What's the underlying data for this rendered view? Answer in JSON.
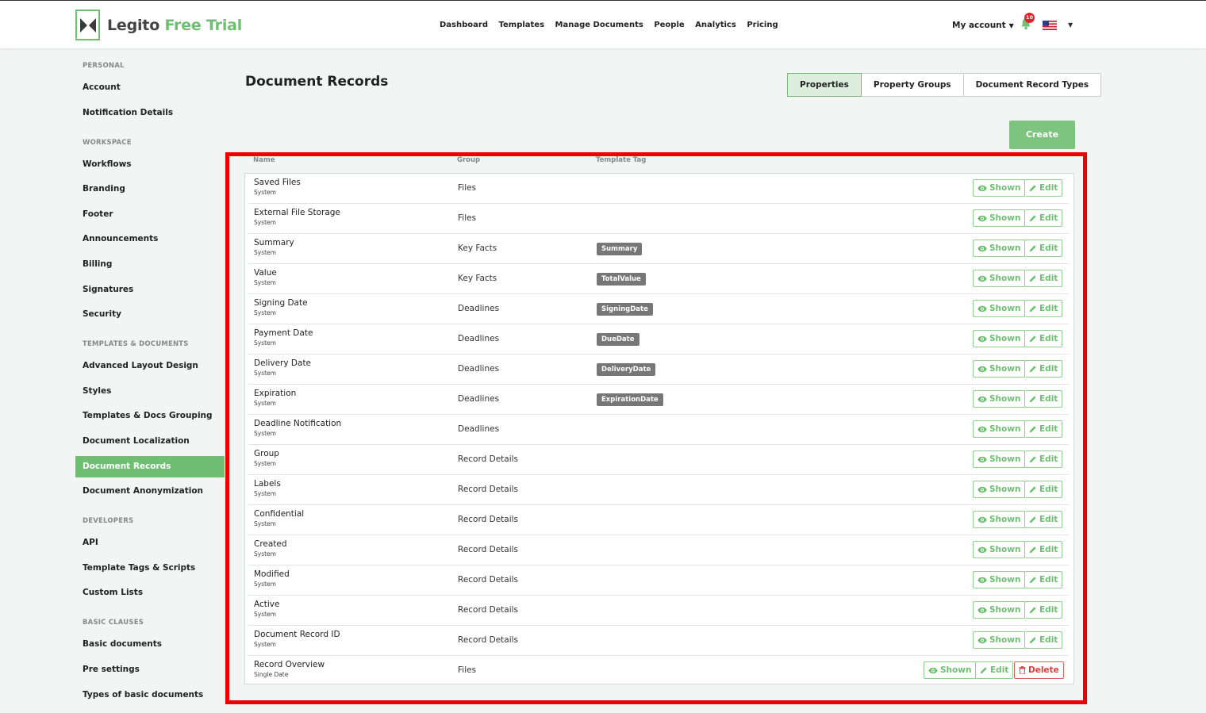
{
  "header": {
    "logo_main": "Legito",
    "logo_accent": "Free Trial",
    "nav": [
      "Dashboard",
      "Templates",
      "Manage Documents",
      "People",
      "Analytics",
      "Pricing"
    ],
    "account_label": "My account",
    "notification_count": "10",
    "language_flag": "us-flag-icon"
  },
  "sidebar": {
    "sections": [
      {
        "title": "PERSONAL",
        "items": [
          "Account",
          "Notification Details"
        ]
      },
      {
        "title": "WORKSPACE",
        "items": [
          "Workflows",
          "Branding",
          "Footer",
          "Announcements",
          "Billing",
          "Signatures",
          "Security"
        ]
      },
      {
        "title": "TEMPLATES & DOCUMENTS",
        "items": [
          "Advanced Layout Design",
          "Styles",
          "Templates & Docs Grouping",
          "Document Localization",
          "Document Records",
          "Document Anonymization"
        ]
      },
      {
        "title": "DEVELOPERS",
        "items": [
          "API",
          "Template Tags & Scripts",
          "Custom Lists"
        ]
      },
      {
        "title": "BASIC CLAUSES",
        "items": [
          "Basic documents",
          "Pre settings",
          "Types of basic documents"
        ]
      }
    ],
    "active_item": "Document Records"
  },
  "main": {
    "title": "Document Records",
    "tabs": [
      "Properties",
      "Property Groups",
      "Document Record Types"
    ],
    "active_tab": "Properties",
    "create_label": "Create",
    "columns": [
      "Name",
      "Group",
      "Template Tag"
    ],
    "shown_label": "Shown",
    "edit_label": "Edit",
    "delete_label": "Delete",
    "rows": [
      {
        "name": "Saved Files",
        "type": "System",
        "group": "Files",
        "tag": ""
      },
      {
        "name": "External File Storage",
        "type": "System",
        "group": "Files",
        "tag": ""
      },
      {
        "name": "Summary",
        "type": "System",
        "group": "Key Facts",
        "tag": "Summary"
      },
      {
        "name": "Value",
        "type": "System",
        "group": "Key Facts",
        "tag": "TotalValue"
      },
      {
        "name": "Signing Date",
        "type": "System",
        "group": "Deadlines",
        "tag": "SigningDate"
      },
      {
        "name": "Payment Date",
        "type": "System",
        "group": "Deadlines",
        "tag": "DueDate"
      },
      {
        "name": "Delivery Date",
        "type": "System",
        "group": "Deadlines",
        "tag": "DeliveryDate"
      },
      {
        "name": "Expiration",
        "type": "System",
        "group": "Deadlines",
        "tag": "ExpirationDate"
      },
      {
        "name": "Deadline Notification",
        "type": "System",
        "group": "Deadlines",
        "tag": ""
      },
      {
        "name": "Group",
        "type": "System",
        "group": "Record Details",
        "tag": ""
      },
      {
        "name": "Labels",
        "type": "System",
        "group": "Record Details",
        "tag": ""
      },
      {
        "name": "Confidential",
        "type": "System",
        "group": "Record Details",
        "tag": ""
      },
      {
        "name": "Created",
        "type": "System",
        "group": "Record Details",
        "tag": ""
      },
      {
        "name": "Modified",
        "type": "System",
        "group": "Record Details",
        "tag": ""
      },
      {
        "name": "Active",
        "type": "System",
        "group": "Record Details",
        "tag": ""
      },
      {
        "name": "Document Record ID",
        "type": "System",
        "group": "Record Details",
        "tag": ""
      },
      {
        "name": "Record Overview",
        "type": "Single Date",
        "group": "Files",
        "tag": "",
        "deletable": true
      }
    ]
  },
  "colors": {
    "accent": "#6fbf73",
    "danger": "#e03c3c",
    "highlight_frame": "#ee0000"
  }
}
